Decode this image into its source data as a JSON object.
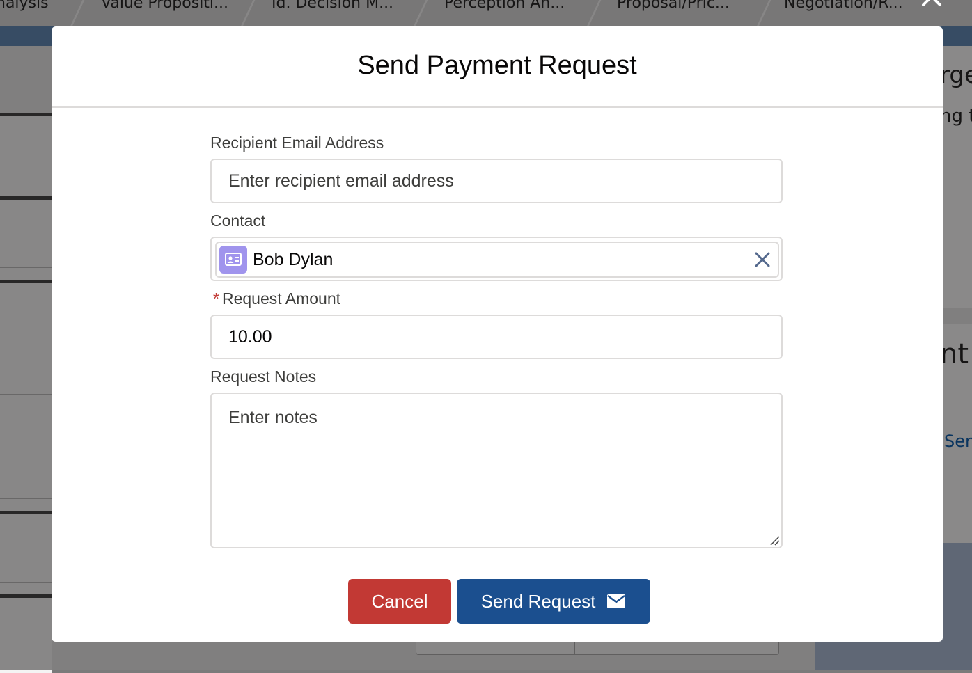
{
  "background": {
    "path_steps": [
      "nalysis",
      "Value Propositi...",
      "Id. Decision M...",
      "Perception An...",
      "Proposal/Pric...",
      "Negotiation/R..."
    ],
    "right_fragments": {
      "heading_fragment": "rge",
      "text_fragment": "ng to",
      "big_fragment": "nt A",
      "link_fragment": "Sen"
    }
  },
  "modal": {
    "title": "Send Payment Request",
    "close_icon": "close-icon"
  },
  "form": {
    "recipient_email": {
      "label": "Recipient Email Address",
      "value": "",
      "placeholder": "Enter recipient email address"
    },
    "contact": {
      "label": "Contact",
      "selected_name": "Bob Dylan",
      "icon": "contact-card-icon",
      "remove_icon": "close-icon"
    },
    "request_amount": {
      "label": "Request Amount",
      "required_marker": "*",
      "value": "10.00"
    },
    "request_notes": {
      "label": "Request Notes",
      "value": "",
      "placeholder": "Enter notes"
    }
  },
  "footer": {
    "cancel_label": "Cancel",
    "send_label": "Send Request",
    "send_icon": "envelope-icon"
  },
  "colors": {
    "cancel": "#c23934",
    "send": "#1b4f8f",
    "contact_icon": "#a094ed",
    "required": "#c23934"
  }
}
